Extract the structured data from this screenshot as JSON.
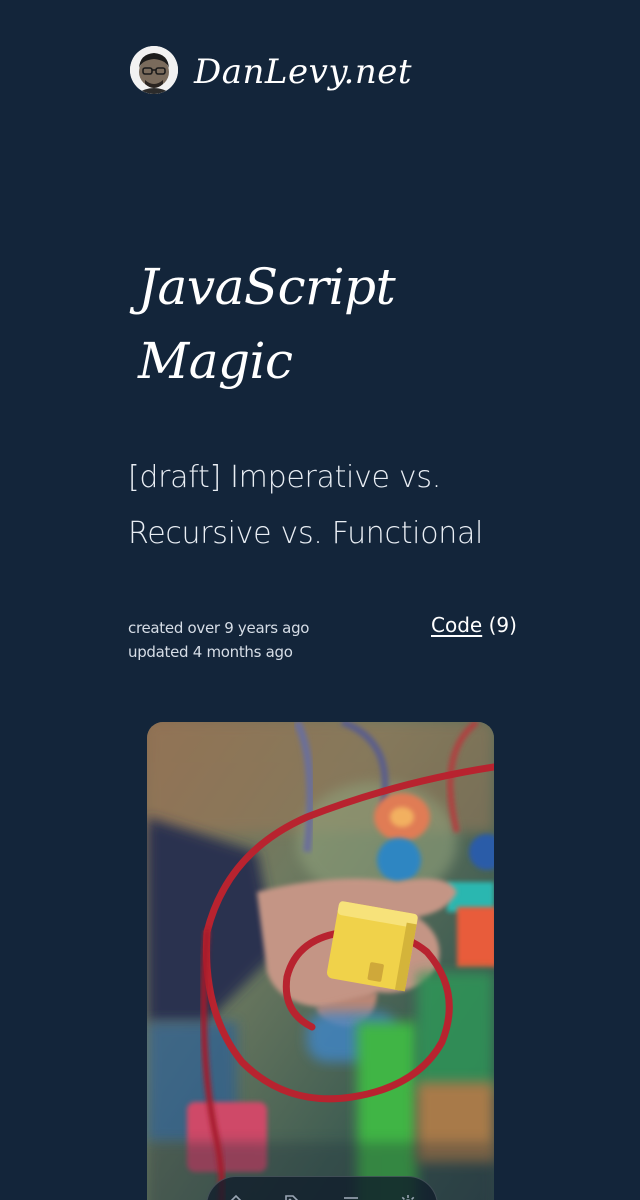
{
  "header": {
    "site_name": "DanLevy.net"
  },
  "category_heading": {
    "line1": "JavaScript",
    "line2": "Magic"
  },
  "post": {
    "title_line1": "[draft] Imperative vs.",
    "title_line2": "Recursive vs. Functional",
    "created": "created over 9 years ago",
    "updated": "updated 4 months ago",
    "category_link": "Code",
    "category_count": "(9)"
  },
  "toolbar": {
    "icons": [
      "home-icon",
      "tag-icon",
      "menu-icon",
      "settings-icon"
    ]
  },
  "colors": {
    "background": "#13253a",
    "text": "#ffffff",
    "meta_text": "#d6dde6"
  }
}
